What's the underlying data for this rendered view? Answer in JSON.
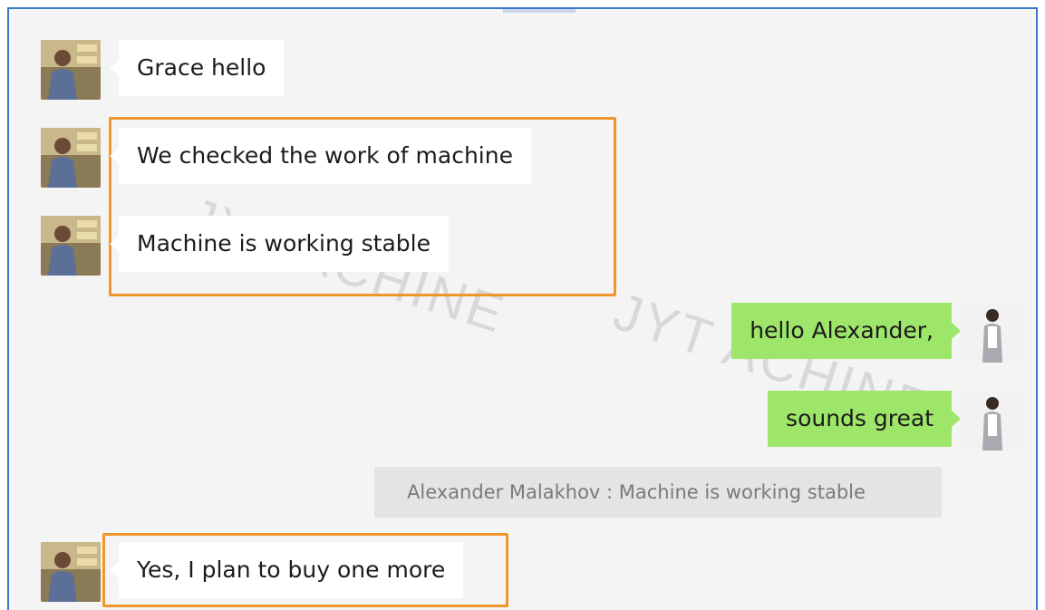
{
  "messages": [
    {
      "side": "incoming",
      "text": "Grace hello"
    },
    {
      "side": "incoming",
      "text": "We checked the work of machine"
    },
    {
      "side": "incoming",
      "text": "Machine is working stable"
    },
    {
      "side": "outgoing",
      "text": "hello Alexander,"
    },
    {
      "side": "outgoing",
      "text": "sounds great"
    },
    {
      "side": "quote",
      "text": "Alexander Malakhov : Machine is working stable"
    },
    {
      "side": "incoming",
      "text": "Yes, I plan to buy one more"
    }
  ],
  "watermark": "JYT ACHINE",
  "colors": {
    "window_border": "#3c78c8",
    "chat_background": "#f4f4f4",
    "incoming_bubble": "#ffffff",
    "outgoing_bubble": "#9ee66a",
    "quote_background": "#e4e4e4",
    "highlight_border": "#f0952a"
  },
  "icons": {
    "incoming_avatar": "man-avatar-photo",
    "outgoing_avatar": "woman-avatar-photo"
  }
}
